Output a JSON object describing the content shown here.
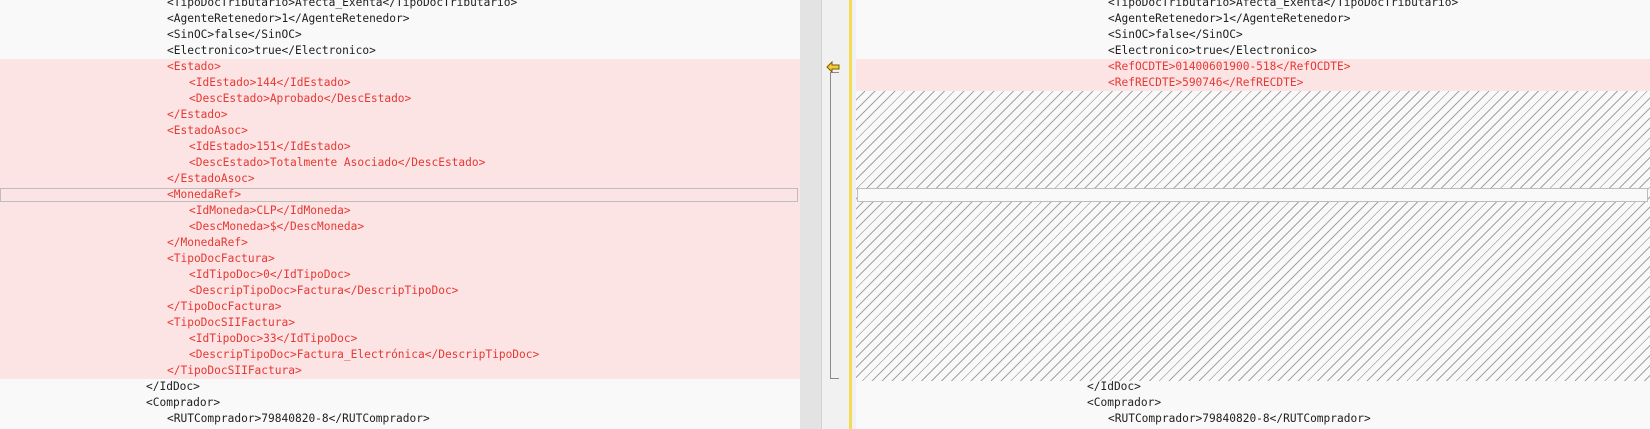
{
  "left": {
    "lines": [
      "<TipoDocTributario>Afecta_Exenta</TipoDocTributario>",
      "<AgenteRetenedor>1</AgenteRetenedor>",
      "<SinOC>false</SinOC>",
      "<Electronico>true</Electronico>",
      "<Estado>",
      "<IdEstado>144</IdEstado>",
      "<DescEstado>Aprobado</DescEstado>",
      "</Estado>",
      "<EstadoAsoc>",
      "<IdEstado>151</IdEstado>",
      "<DescEstado>Totalmente Asociado</DescEstado>",
      "</EstadoAsoc>",
      "<MonedaRef>",
      "<IdMoneda>CLP</IdMoneda>",
      "<DescMoneda>$</DescMoneda>",
      "</MonedaRef>",
      "<TipoDocFactura>",
      "<IdTipoDoc>0</IdTipoDoc>",
      "<DescripTipoDoc>Factura</DescripTipoDoc>",
      "</TipoDocFactura>",
      "<TipoDocSIIFactura>",
      "<IdTipoDoc>33</IdTipoDoc>",
      "<DescripTipoDoc>Factura_Electrónica</DescripTipoDoc>",
      "</TipoDocSIIFactura>",
      "</IdDoc>",
      "<Comprador>",
      "<RUTComprador>79840820-8</RUTComprador>"
    ]
  },
  "right": {
    "lines": [
      "<TipoDocTributario>Afecta_Exenta</TipoDocTributario>",
      "<AgenteRetenedor>1</AgenteRetenedor>",
      "<SinOC>false</SinOC>",
      "<Electronico>true</Electronico>",
      "<RefOCDTE>01400601900-518</RefOCDTE>",
      "<RefRECDTE>590746</RefRECDTE>",
      "</IdDoc>",
      "<Comprador>",
      "<RUTComprador>79840820-8</RUTComprador>"
    ]
  },
  "gutter": {
    "icon": "copy-left-arrow-icon"
  },
  "colors": {
    "diff_background": "#fde4e4",
    "diff_text": "#e53935",
    "normal_text": "#1e1e1e",
    "marker": "#f2dc55"
  }
}
